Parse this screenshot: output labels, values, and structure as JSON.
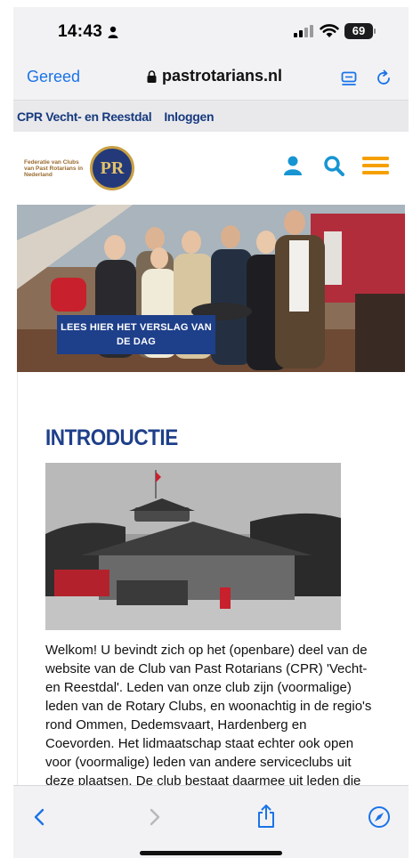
{
  "status_bar": {
    "time": "14:43",
    "battery": "69"
  },
  "browser": {
    "done_label": "Gereed",
    "url": "pastrotarians.nl"
  },
  "site": {
    "topnav": {
      "club_link": "CPR Vecht- en Reestdal",
      "login_link": "Inloggen"
    },
    "logo": {
      "text": "Federatie van Clubs van Past Rotarians in Nederland",
      "monogram": "PR"
    },
    "hero": {
      "button_label": "LEES HIER HET VERSLAG VAN DE DAG"
    },
    "intro": {
      "title": "INTRODUCTIE",
      "body": "Welkom! U bevindt zich op het (openbare) deel van de website van de Club van Past Rotarians (CPR) 'Vecht- en Reestdal'. Leden van onze club zijn (voormalige) leden van de Rotary Clubs, en woonachtig in de regio's rond Ommen, Dedemsvaart, Hardenberg en Coevorden. Het lidmaatschap staat echter ook open voor (voormalige) leden van andere serviceclubs uit deze plaatsen. De club bestaat daarmee uit leden die"
    }
  },
  "icons": {
    "header": [
      "user-icon",
      "search-icon",
      "menu-icon"
    ],
    "toolbar": [
      "back-icon",
      "forward-icon",
      "share-icon",
      "compass-icon"
    ]
  },
  "colors": {
    "ios_blue": "#1a73e8",
    "brand_navy": "#1e3f8a",
    "site_accent": "#1795d3",
    "menu_orange": "#f5a000"
  }
}
